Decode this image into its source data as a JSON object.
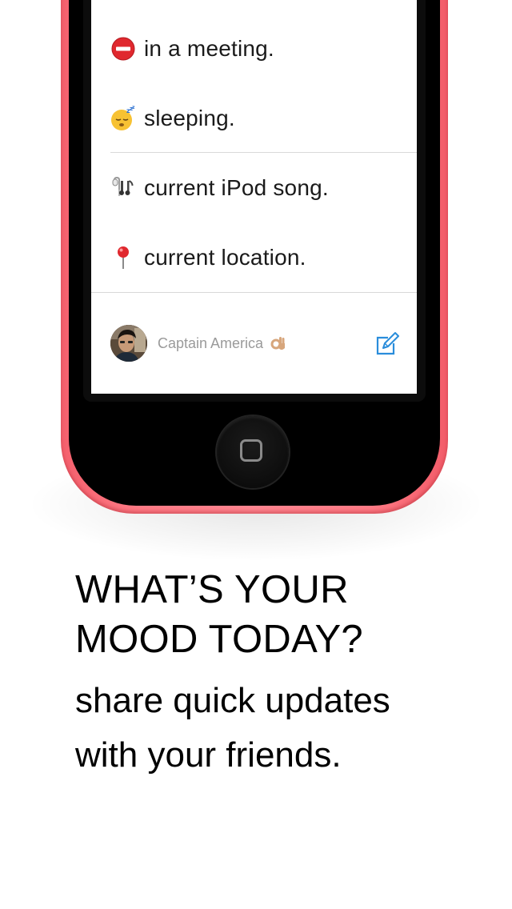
{
  "statuses": [
    {
      "icon": "no-entry-icon",
      "label": "in a meeting."
    },
    {
      "icon": "sleeping-face-icon",
      "label": "sleeping."
    },
    {
      "icon": "earbuds-music-icon",
      "label": "current iPod song."
    },
    {
      "icon": "map-pin-icon",
      "label": "current location."
    }
  ],
  "user": {
    "name": "Captain America",
    "emoji_icon": "ok-hand-icon"
  },
  "compose_icon": "compose-icon",
  "headline": {
    "line1": "WHAT’S YOUR",
    "line2": "MOOD TODAY?"
  },
  "subheadline": {
    "line1": "share quick updates",
    "line2": "with your friends."
  },
  "colors": {
    "phone_body": "#ff7a85",
    "accent_blue": "#2a8ddb",
    "no_entry_red": "#e0282e",
    "text_gray": "#9a9a9a"
  }
}
